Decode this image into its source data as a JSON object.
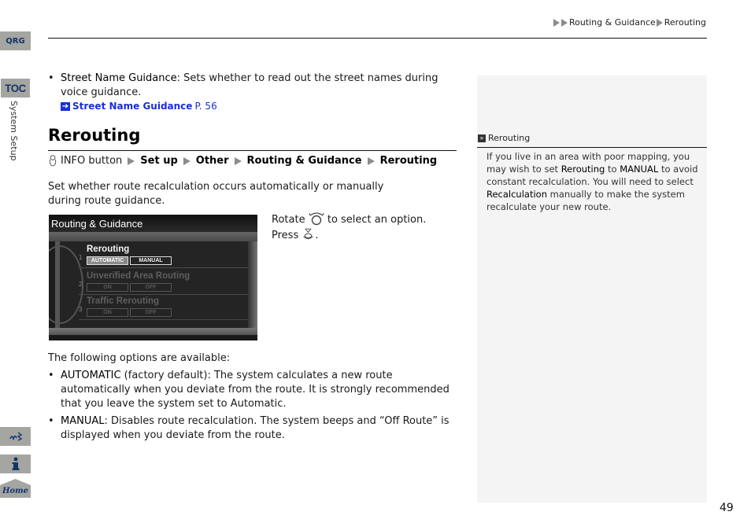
{
  "side_nav": {
    "qrg_label": "QRG",
    "toc_label": "TOC",
    "section_label": "System Setup",
    "voice_icon": "voice-command-icon",
    "info_icon": "info-icon",
    "home_label": "Home"
  },
  "header": {
    "breadcrumb": [
      "Routing & Guidance",
      "Rerouting"
    ]
  },
  "street_name": {
    "term": "Street Name Guidance",
    "description": ": Sets whether to read out the street names during voice guidance.",
    "xref_label": "Street Name Guidance",
    "xref_page": "P. 56"
  },
  "section": {
    "title": "Rerouting",
    "nav_path": {
      "start": "INFO button",
      "steps": [
        "Set up",
        "Other",
        "Routing & Guidance",
        "Rerouting"
      ]
    },
    "intro": "Set whether route recalculation occurs automatically or manually during route guidance."
  },
  "screen": {
    "title": "Routing & Guidance",
    "rows": [
      {
        "num": "1",
        "label": "Rerouting",
        "options": [
          "AUTOMATIC",
          "MANUAL"
        ],
        "selected": "AUTOMATIC",
        "active": true
      },
      {
        "num": "2",
        "label": "Unverified Area Routing",
        "options": [
          "ON",
          "OFF"
        ],
        "active": false
      },
      {
        "num": "3",
        "label": "Traffic Rerouting",
        "options": [
          "ON",
          "OFF"
        ],
        "active": false
      }
    ]
  },
  "instructions": {
    "rotate_pre": "Rotate",
    "rotate_post": "to select an option.",
    "press_pre": "Press",
    "press_post": "."
  },
  "options": {
    "intro": "The following options are available:",
    "automatic_term": "AUTOMATIC",
    "automatic_desc": " (factory default): The system calculates a new route automatically when you deviate from the route. It is strongly recommended that you leave the system set to Automatic.",
    "manual_term": "MANUAL",
    "manual_desc": ": Disables route recalculation. The system beeps and “Off Route” is displayed when you deviate from the route."
  },
  "note": {
    "heading": "Rerouting",
    "parts": [
      "If you live in an area with poor mapping, you may wish to set ",
      "Rerouting",
      " to ",
      "MANUAL",
      " to avoid constant recalculation. You will need to select ",
      "Recalculation",
      " manually to make the system recalculate your new route."
    ]
  },
  "page_number": "49",
  "colors": {
    "tab_bg": "#a5a6a1",
    "tab_text": "#13356d",
    "link": "#1a2fd6",
    "note_bg": "#f4f4f4"
  }
}
